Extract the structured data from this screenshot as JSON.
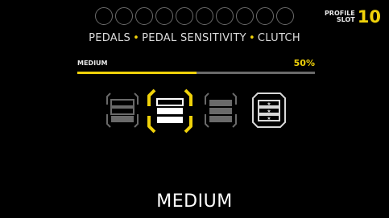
{
  "profile": {
    "label_line1": "PROFILE",
    "label_line2": "SLOT",
    "number": "10",
    "dots_total": 10
  },
  "breadcrumb": {
    "items": [
      "PEDALS",
      "PEDAL SENSITIVITY",
      "CLUTCH"
    ],
    "separator": "•"
  },
  "slider": {
    "label": "MEDIUM",
    "value_text": "50%",
    "fraction": 0.5
  },
  "options": [
    {
      "id": "low",
      "icon": "sensitivity-low-icon",
      "selected": false
    },
    {
      "id": "medium",
      "icon": "sensitivity-medium-icon",
      "selected": true
    },
    {
      "id": "high",
      "icon": "sensitivity-high-icon",
      "selected": false
    },
    {
      "id": "custom",
      "icon": "sensitivity-custom-icon",
      "selected": false
    }
  ],
  "selected_caption": "MEDIUM",
  "colors": {
    "accent": "#f0d20a",
    "inactive": "#6a6a6a",
    "background": "#000000",
    "text": "#dcdcdc"
  }
}
